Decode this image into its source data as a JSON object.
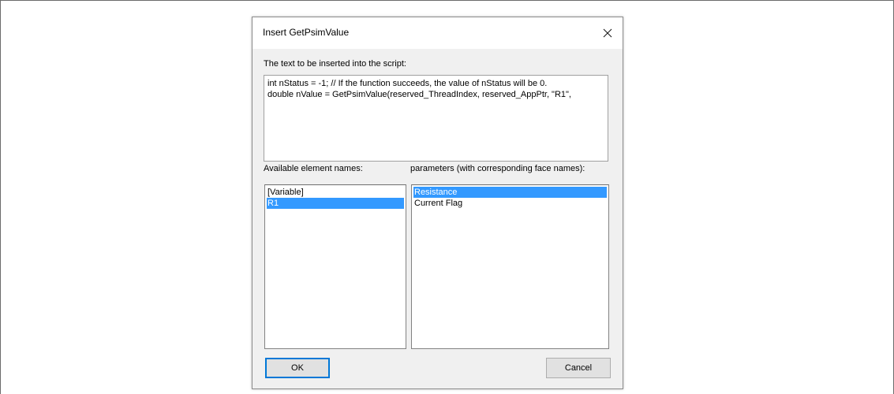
{
  "dialog": {
    "title": "Insert GetPsimValue",
    "script_label": "The text to be inserted into the script:",
    "script_lines": [
      "int nStatus = -1; // If the function succeeds, the value of nStatus will be 0.",
      "double nValue = GetPsimValue(reserved_ThreadIndex, reserved_AppPtr, \"R1\","
    ],
    "elements_label": "Available element names:",
    "params_label": "parameters (with corresponding face names):",
    "elements": [
      {
        "label": "[Variable]",
        "selected": false
      },
      {
        "label": "R1",
        "selected": true
      }
    ],
    "parameters": [
      {
        "label": "Resistance",
        "selected": true
      },
      {
        "label": "Current Flag",
        "selected": false
      }
    ],
    "ok_label": "OK",
    "cancel_label": "Cancel"
  },
  "icons": {
    "close": "close-icon"
  },
  "colors": {
    "selection": "#3399ff",
    "dialog_bg": "#f0f0f0",
    "titlebar_bg": "#ffffff"
  }
}
